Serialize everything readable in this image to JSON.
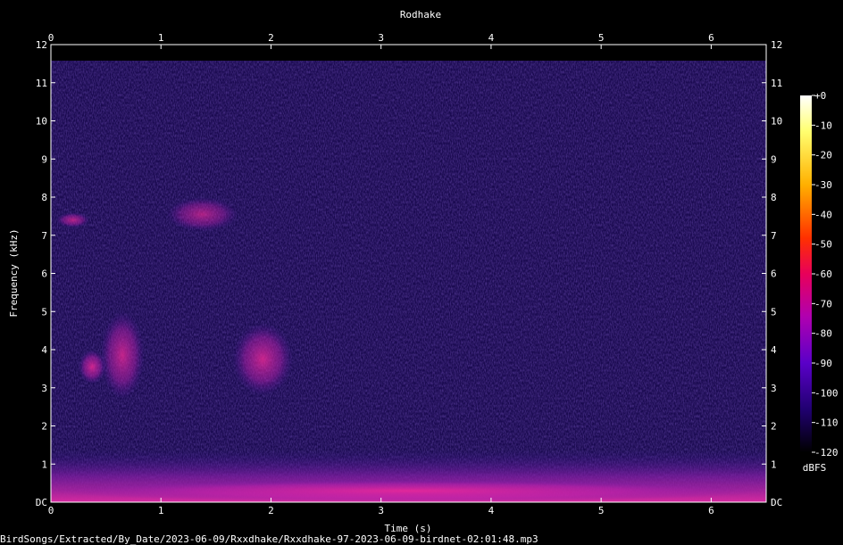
{
  "chart_data": {
    "type": "heatmap",
    "title": "Rodhake",
    "xlabel": "Time (s)",
    "ylabel": "Frequency (kHz)",
    "xlim": [
      0,
      6.5
    ],
    "ylim": [
      0,
      12
    ],
    "x_ticks": [
      "0",
      "1",
      "2",
      "3",
      "4",
      "5",
      "6"
    ],
    "y_ticks": [
      "DC",
      "1",
      "2",
      "3",
      "4",
      "5",
      "6",
      "7",
      "8",
      "9",
      "10",
      "11",
      "12"
    ],
    "colorbar": {
      "label": "dBFS",
      "ticks": [
        "+0",
        "-10",
        "-20",
        "-30",
        "-40",
        "-50",
        "-60",
        "-70",
        "-80",
        "-90",
        "-100",
        "-110",
        "-120"
      ],
      "range": [
        -120,
        0
      ]
    },
    "series": [
      {
        "t_start": 0.05,
        "t_end": 0.35,
        "f_low": 7.2,
        "f_high": 7.6,
        "level_db": -75
      },
      {
        "t_start": 0.25,
        "t_end": 0.5,
        "f_low": 3.1,
        "f_high": 4.0,
        "level_db": -68
      },
      {
        "t_start": 0.45,
        "t_end": 0.85,
        "f_low": 2.7,
        "f_high": 5.0,
        "level_db": -72
      },
      {
        "t_start": 1.05,
        "t_end": 1.7,
        "f_low": 7.1,
        "f_high": 8.0,
        "level_db": -78
      },
      {
        "t_start": 1.65,
        "t_end": 2.2,
        "f_low": 2.8,
        "f_high": 4.7,
        "level_db": -70
      },
      {
        "t_start": 0.0,
        "t_end": 6.5,
        "f_low": 0.0,
        "f_high": 0.6,
        "level_db": -75
      }
    ]
  },
  "footer": {
    "file_path": "BirdSongs/Extracted/By_Date/2023-06-09/Rxxdhake/Rxxdhake-97-2023-06-09-birdnet-02:01:48.mp3"
  },
  "colors": {
    "background": "#000000",
    "plot_base": "#1a0a50",
    "hot": "#ff2a9a",
    "text": "#ffffff"
  }
}
